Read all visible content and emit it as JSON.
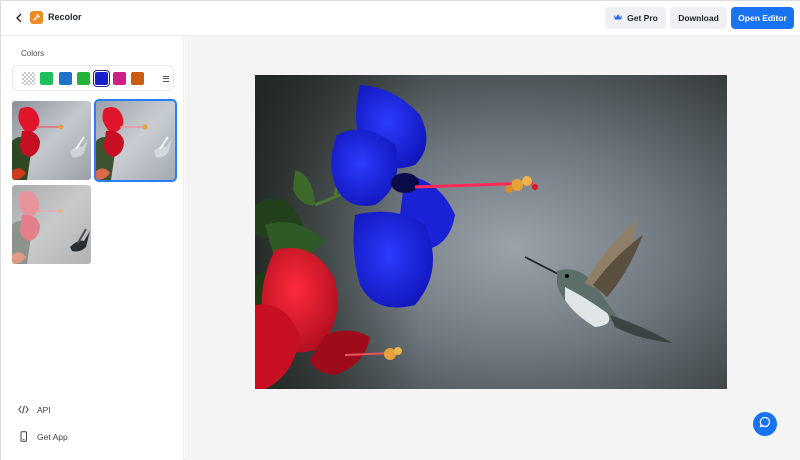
{
  "header": {
    "app_title": "Recolor",
    "get_pro_label": "Get Pro",
    "download_label": "Download",
    "open_editor_label": "Open Editor"
  },
  "sidebar": {
    "colors_label": "Colors",
    "swatches": [
      {
        "name": "transparent",
        "color": "transparent"
      },
      {
        "name": "green",
        "color": "#1fbf5c"
      },
      {
        "name": "blue",
        "color": "#1c73c9"
      },
      {
        "name": "lime-green",
        "color": "#26b33a"
      },
      {
        "name": "royal-blue",
        "color": "#1a1fc9",
        "selected": true
      },
      {
        "name": "magenta",
        "color": "#cf1f86"
      },
      {
        "name": "orange",
        "color": "#cc5b14"
      }
    ],
    "links": [
      {
        "label": "API",
        "icon": "code-icon"
      },
      {
        "label": "Get App",
        "icon": "phone-icon"
      }
    ]
  },
  "colors": {
    "accent": "#1773f0",
    "flower_blue": "#1a1fe0",
    "flower_red": "#e0142a"
  }
}
